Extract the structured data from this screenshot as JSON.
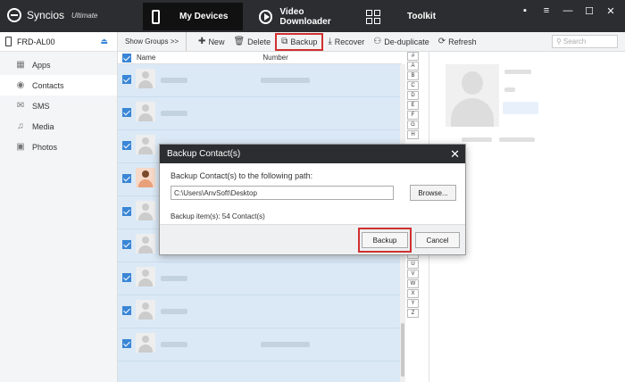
{
  "app": {
    "name": "Syncios",
    "edition": "Ultimate"
  },
  "nav": {
    "my_devices": "My Devices",
    "video_downloader": "Video Downloader",
    "toolkit": "Toolkit"
  },
  "window_controls": [
    "▪",
    "≡",
    "—",
    "☐",
    "✕"
  ],
  "device": {
    "name": "FRD-AL00"
  },
  "sidebar": {
    "items": [
      {
        "label": "Apps",
        "icon": "apps-icon"
      },
      {
        "label": "Contacts",
        "icon": "contacts-icon"
      },
      {
        "label": "SMS",
        "icon": "sms-icon"
      },
      {
        "label": "Media",
        "icon": "media-icon"
      },
      {
        "label": "Photos",
        "icon": "photos-icon"
      }
    ]
  },
  "toolbar": {
    "show_groups": "Show Groups >>",
    "new": "New",
    "delete": "Delete",
    "backup": "Backup",
    "recover": "Recover",
    "deduplicate": "De-duplicate",
    "refresh": "Refresh",
    "search_placeholder": "Search"
  },
  "list": {
    "col_name": "Name",
    "col_number": "Number"
  },
  "alphabet_top": [
    "#",
    "A",
    "B",
    "C",
    "D",
    "E",
    "F",
    "G",
    "H"
  ],
  "alphabet_bottom": [
    "I",
    "U",
    "V",
    "W",
    "X",
    "Y",
    "Z"
  ],
  "dialog": {
    "title": "Backup Contact(s)",
    "label": "Backup Contact(s) to the following path:",
    "path": "C:\\Users\\AnvSoft\\Desktop",
    "browse": "Browse...",
    "items": "Backup item(s): 54 Contact(s)",
    "backup": "Backup",
    "cancel": "Cancel"
  }
}
